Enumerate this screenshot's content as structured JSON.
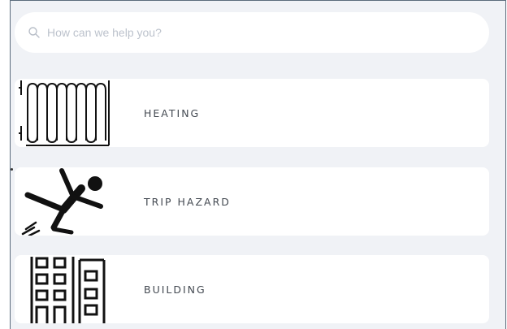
{
  "search": {
    "placeholder": "How can we help you?",
    "icon": "search-icon"
  },
  "categories": [
    {
      "label": "HEATING",
      "icon": "radiator-icon"
    },
    {
      "label": "TRIP HAZARD",
      "icon": "trip-hazard-icon"
    },
    {
      "label": "BUILDING",
      "icon": "building-icon"
    }
  ],
  "colors": {
    "background": "#f0f2f6",
    "card": "#ffffff",
    "label_text": "#444a52",
    "placeholder": "#bcc2cc"
  }
}
